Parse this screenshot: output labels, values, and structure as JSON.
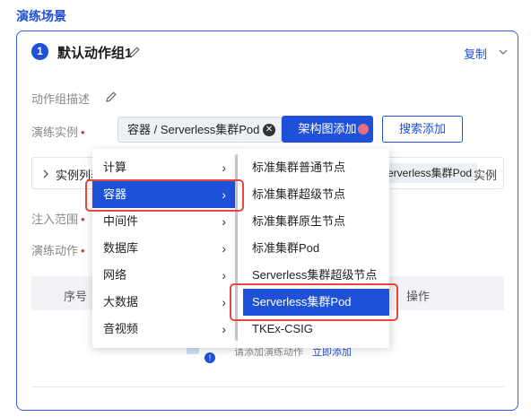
{
  "section_title": "演练场景",
  "group": {
    "number": "1",
    "title": "默认动作组1",
    "copy_label": "复制"
  },
  "fields": {
    "desc_label": "动作组描述",
    "instance_label": "演练实例",
    "inject_label": "注入范围",
    "action_label": "演练动作"
  },
  "instance_input": {
    "value": "容器 / Serverless集群Pod"
  },
  "buttons": {
    "arch_add": "架构图添加",
    "search_add": "搜索添加"
  },
  "instance_list": {
    "label": "实例列表",
    "tag": "Serverless集群Pod",
    "suffix": "实例"
  },
  "table": {
    "col_index": "序号",
    "col_ops": "操作",
    "empty_text": "请添加演练动作",
    "empty_link": "立即添加"
  },
  "menu_level1": [
    {
      "label": "计算",
      "active": false
    },
    {
      "label": "容器",
      "active": true
    },
    {
      "label": "中间件",
      "active": false
    },
    {
      "label": "数据库",
      "active": false
    },
    {
      "label": "网络",
      "active": false
    },
    {
      "label": "大数据",
      "active": false
    },
    {
      "label": "音视频",
      "active": false
    }
  ],
  "menu_level2": [
    {
      "label": "标准集群普通节点",
      "active": false
    },
    {
      "label": "标准集群超级节点",
      "active": false
    },
    {
      "label": "标准集群原生节点",
      "active": false
    },
    {
      "label": "标准集群Pod",
      "active": false
    },
    {
      "label": "Serverless集群超级节点",
      "active": false
    },
    {
      "label": "Serverless集群Pod",
      "active": true
    },
    {
      "label": "TKEx-CSIG",
      "active": false
    }
  ],
  "icons": {
    "edit": "pencil-icon",
    "chevron": "chevron-down-icon",
    "clear": "close-circle-icon",
    "arrow": "chevron-right-icon"
  },
  "colors": {
    "primary": "#1e51d8",
    "highlight_outline": "#e8453c"
  }
}
